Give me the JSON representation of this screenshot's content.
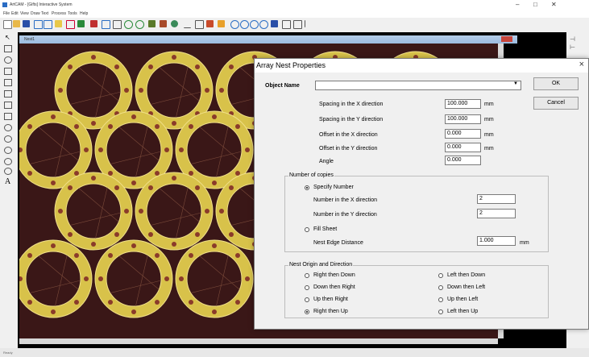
{
  "app": {
    "title": "ArtCAM - [Gifts] Interactive System",
    "menu": [
      "File",
      "Edit",
      "View",
      "Draw",
      "Text",
      "Process",
      "Tools",
      "Help"
    ],
    "status_text": "Ready"
  },
  "document": {
    "title": "Nest1"
  },
  "colors": {
    "canvas_bg": "#3a1717",
    "ring": "#d8c24a",
    "ring_hole": "#8a3b2a",
    "accent": "#2a6dc4"
  },
  "dialog": {
    "title": "Array Nest Properties",
    "close_glyph": "×",
    "object_name_label": "Object Name",
    "object_name_value": "",
    "ok_label": "OK",
    "cancel_label": "Cancel",
    "fields": [
      {
        "label": "Spacing in the X direction",
        "value": "100.000",
        "unit": "mm"
      },
      {
        "label": "Spacing in the Y direction",
        "value": "100.000",
        "unit": "mm"
      },
      {
        "label": "Offset in the X direction",
        "value": "0.000",
        "unit": "mm"
      },
      {
        "label": "Offset in the Y direction",
        "value": "0.000",
        "unit": "mm"
      },
      {
        "label": "Angle",
        "value": "0.000",
        "unit": ""
      }
    ],
    "copies": {
      "group_label": "Number of copies",
      "specify_label": "Specify Number",
      "specify_selected": true,
      "nx_label": "Number in the X direction",
      "nx_value": "2",
      "ny_label": "Number in the Y direction",
      "ny_value": "2",
      "fill_label": "Fill Sheet",
      "fill_selected": false,
      "edge_label": "Nest Edge Distance",
      "edge_value": "1.000",
      "edge_unit": "mm"
    },
    "origin": {
      "group_label": "Nest Origin and Direction",
      "options": [
        {
          "label": "Right then Down",
          "selected": false
        },
        {
          "label": "Down then Right",
          "selected": false
        },
        {
          "label": "Up then Right",
          "selected": false
        },
        {
          "label": "Right then Up",
          "selected": true
        },
        {
          "label": "Left then Down",
          "selected": false
        },
        {
          "label": "Down then Left",
          "selected": false
        },
        {
          "label": "Up then Left",
          "selected": false
        },
        {
          "label": "Left then Up",
          "selected": false
        }
      ]
    }
  }
}
